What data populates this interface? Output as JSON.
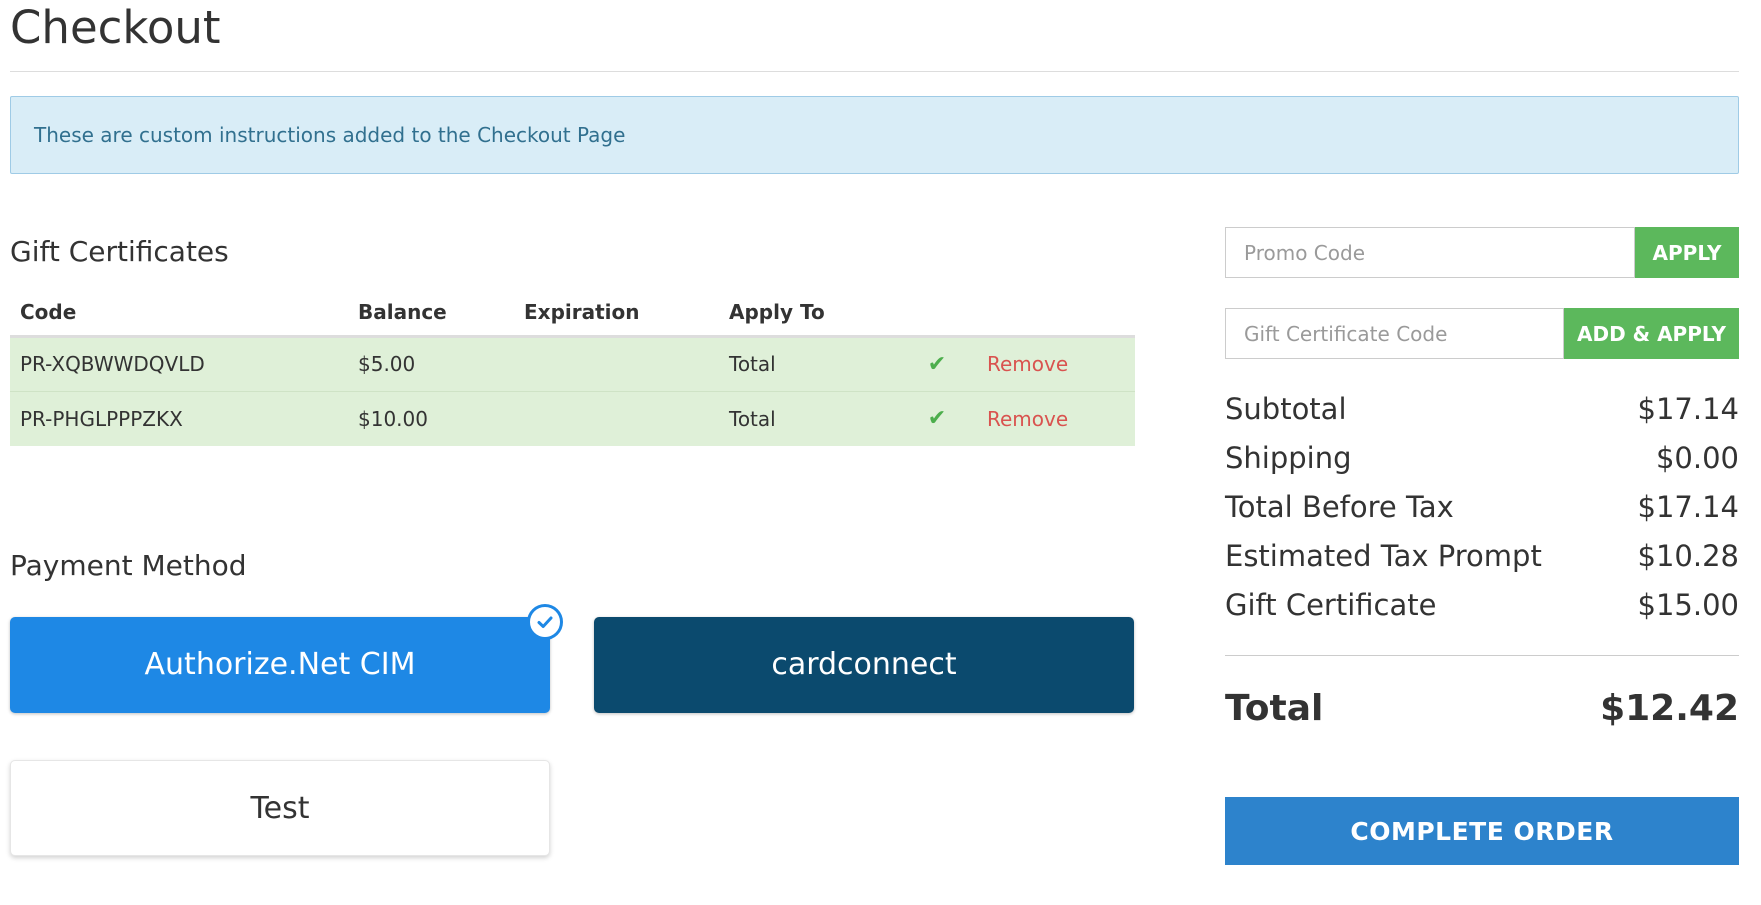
{
  "page": {
    "title": "Checkout"
  },
  "alert": {
    "text": "These are custom instructions added to the Checkout Page"
  },
  "gift_certificates": {
    "heading": "Gift Certificates",
    "columns": {
      "code": "Code",
      "balance": "Balance",
      "expiration": "Expiration",
      "apply_to": "Apply To"
    },
    "rows": [
      {
        "code": "PR-XQBWWDQVLD",
        "balance": "$5.00",
        "expiration": "",
        "apply_to": "Total",
        "status_icon": "check-icon",
        "action": "Remove"
      },
      {
        "code": "PR-PHGLPPPZKX",
        "balance": "$10.00",
        "expiration": "",
        "apply_to": "Total",
        "status_icon": "check-icon",
        "action": "Remove"
      }
    ]
  },
  "payment_method": {
    "heading": "Payment Method",
    "options": [
      {
        "label": "Authorize.Net CIM",
        "selected": true
      },
      {
        "label": "cardconnect",
        "selected": false
      },
      {
        "label": "Test",
        "selected": false
      }
    ],
    "selected_icon": "circle-check-icon"
  },
  "promo": {
    "placeholder": "Promo Code",
    "button": "APPLY"
  },
  "gift_code": {
    "placeholder": "Gift Certificate Code",
    "button": "ADD & APPLY"
  },
  "summary": {
    "rows": [
      {
        "label": "Subtotal",
        "value": "$17.14"
      },
      {
        "label": "Shipping",
        "value": "$0.00"
      },
      {
        "label": "Total Before Tax",
        "value": "$17.14"
      },
      {
        "label": "Estimated Tax Prompt",
        "value": "$10.28"
      },
      {
        "label": "Gift Certificate",
        "value": "$15.00"
      }
    ],
    "total_label": "Total",
    "total_value": "$12.42"
  },
  "complete_order": {
    "label": "COMPLETE ORDER"
  },
  "colors": {
    "alert_bg": "#d9edf7",
    "success_row_bg": "#dff0d8",
    "primary_blue": "#1e88e5",
    "dark_blue": "#0b4a6e",
    "green": "#5cb85c",
    "remove_red": "#d9534f",
    "complete_blue": "#2d83cc"
  }
}
